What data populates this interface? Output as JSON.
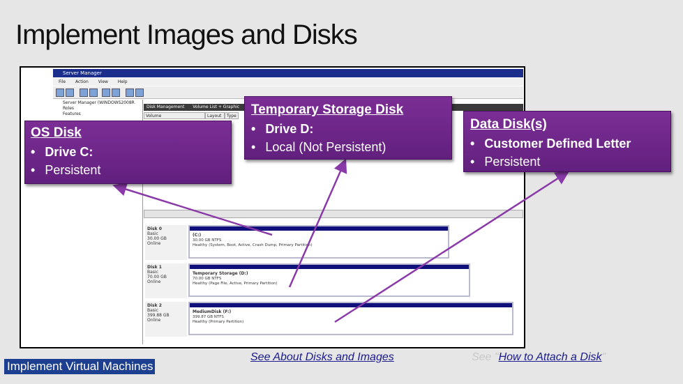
{
  "slide": {
    "title": "Implement Images and Disks",
    "footer_badge": "Implement Virtual Machines",
    "link_about": "See About Disks and Images",
    "note_prefix": "See \"",
    "note_link": "How to Attach a Disk",
    "note_suffix": "\""
  },
  "window": {
    "title": "Server Manager",
    "menu": [
      "File",
      "Action",
      "View",
      "Help"
    ],
    "tree": [
      "Server Manager (WINDOWS2008R",
      "Roles",
      "Features"
    ],
    "pane_title": "Disk Management",
    "pane_sub": "Volume List + Graphic",
    "columns": [
      "Volume",
      "Layout",
      "Type"
    ]
  },
  "disks": [
    {
      "name": "Disk 0",
      "type": "Basic",
      "size": "30.00 GB",
      "status": "Online",
      "part_label": "(C:)",
      "part_size": "30.00 GB NTFS",
      "part_status": "Healthy (System, Boot, Active, Crash Dump, Primary Partition)"
    },
    {
      "name": "Disk 1",
      "type": "Basic",
      "size": "70.00 GB",
      "status": "Online",
      "part_label": "Temporary Storage (D:)",
      "part_size": "70.00 GB NTFS",
      "part_status": "Healthy (Page File, Active, Primary Partition)"
    },
    {
      "name": "Disk 2",
      "type": "Basic",
      "size": "399.88 GB",
      "status": "Online",
      "part_label": "MediumDisk (F:)",
      "part_size": "399.87 GB NTFS",
      "part_status": "Healthy (Primary Partition)"
    }
  ],
  "callouts": {
    "os": {
      "title": "OS Disk",
      "items": [
        "Drive C:",
        "Persistent"
      ]
    },
    "temp": {
      "title": "Temporary Storage Disk",
      "items": [
        "Drive D:",
        "Local (Not Persistent)"
      ]
    },
    "data": {
      "title": "Data Disk(s)",
      "items": [
        "Customer Defined Letter",
        "Persistent"
      ]
    }
  },
  "colors": {
    "callout": "#6a2585",
    "titlebar": "#1b2e8c",
    "partition_bar": "#10107a",
    "badge": "#1c3f8f"
  }
}
